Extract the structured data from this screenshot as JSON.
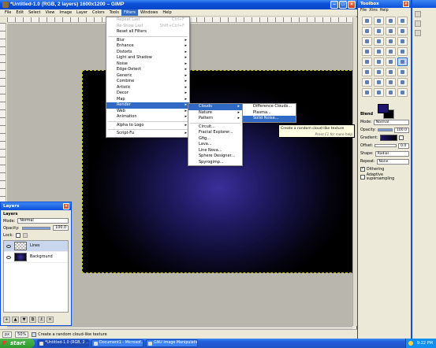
{
  "main_window": {
    "title": "*Untitled-1.0 (RGB, 2 layers) 1600x1200 – GIMP",
    "menus": [
      "File",
      "Edit",
      "Select",
      "View",
      "Image",
      "Layer",
      "Colors",
      "Tools",
      "Filters",
      "Windows",
      "Help"
    ],
    "active_menu": "Filters",
    "status": {
      "unit": "px",
      "zoom": "50%",
      "message": "Create a random cloud-like texture"
    }
  },
  "filters_menu": {
    "items": [
      {
        "label": "Repeat Last",
        "shortcut": "Ctrl+F",
        "disabled": true
      },
      {
        "label": "Re-Show Last",
        "shortcut": "Shift+Ctrl+F",
        "disabled": true
      },
      {
        "label": "Reset all Filters"
      },
      {
        "sep": true
      },
      {
        "label": "Blur",
        "sub": true
      },
      {
        "label": "Enhance",
        "sub": true
      },
      {
        "label": "Distorts",
        "sub": true
      },
      {
        "label": "Light and Shadow",
        "sub": true
      },
      {
        "label": "Noise",
        "sub": true
      },
      {
        "label": "Edge-Detect",
        "sub": true
      },
      {
        "label": "Generic",
        "sub": true
      },
      {
        "label": "Combine",
        "sub": true
      },
      {
        "label": "Artistic",
        "sub": true
      },
      {
        "label": "Decor",
        "sub": true
      },
      {
        "label": "Map",
        "sub": true
      },
      {
        "label": "Render",
        "sub": true,
        "highlight": true
      },
      {
        "label": "Web",
        "sub": true
      },
      {
        "label": "Animation",
        "sub": true
      },
      {
        "sep": true
      },
      {
        "label": "Alpha to Logo",
        "sub": true
      },
      {
        "sep": true
      },
      {
        "label": "Script-Fu",
        "sub": true
      }
    ]
  },
  "render_menu": {
    "items": [
      {
        "label": "Clouds",
        "sub": true,
        "highlight": true
      },
      {
        "label": "Nature",
        "sub": true
      },
      {
        "label": "Pattern",
        "sub": true
      },
      {
        "sep": true
      },
      {
        "label": "Circuit..."
      },
      {
        "label": "Fractal Explorer..."
      },
      {
        "label": "Gfig..."
      },
      {
        "label": "Lava..."
      },
      {
        "label": "Line Nova..."
      },
      {
        "label": "Sphere Designer..."
      },
      {
        "label": "Spyrogimp..."
      }
    ]
  },
  "clouds_menu": {
    "items": [
      {
        "label": "Difference Clouds..."
      },
      {
        "label": "Plasma..."
      },
      {
        "label": "Solid Noise...",
        "highlight": true
      }
    ]
  },
  "tooltip": {
    "text": "Create a random cloud-like texture",
    "hint": "Press F1 for more help"
  },
  "layers_dock": {
    "title": "Layers",
    "tab_label": "Layers",
    "mode_label": "Mode:",
    "mode_value": "Normal",
    "opacity_label": "Opacity:",
    "opacity_value": "100.0",
    "opacity_fraction": 1.0,
    "lock_label": "Lock:",
    "layers": [
      {
        "name": "Lines",
        "selected": true
      },
      {
        "name": "Background",
        "selected": false
      }
    ]
  },
  "toolbox": {
    "title": "Toolbox",
    "menus": [
      "File",
      "Xtns",
      "Help"
    ],
    "tool_icons": [
      "rect-select-icon",
      "ellipse-select-icon",
      "free-select-icon",
      "fuzzy-select-icon",
      "color-select-icon",
      "scissors-icon",
      "paths-icon",
      "color-picker-icon",
      "zoom-icon",
      "measure-icon",
      "move-icon",
      "crop-icon",
      "rotate-icon",
      "scale-icon",
      "shear-icon",
      "perspective-icon",
      "flip-icon",
      "text-icon",
      "bucket-fill-icon",
      "blend-icon",
      "pencil-icon",
      "paintbrush-icon",
      "eraser-icon",
      "airbrush-icon",
      "ink-icon",
      "clone-icon",
      "heal-icon",
      "perspective-clone-icon",
      "smudge-icon",
      "dodge-burn-icon",
      "convolve-icon",
      "foreground-select-icon"
    ],
    "selected_tool": 19,
    "fg_color": "#1f1470",
    "bg_color": "#000000",
    "options": {
      "title": "Blend",
      "mode_label": "Mode:",
      "mode_value": "Normal",
      "opacity_label": "Opacity:",
      "opacity_value": "100.0",
      "gradient_label": "Gradient:",
      "offset_label": "Offset:",
      "offset_value": "0.0",
      "shape_label": "Shape:",
      "shape_value": "Radial",
      "repeat_label": "Repeat:",
      "repeat_value": "None",
      "dithering_label": "Dithering",
      "adaptive_label": "Adaptive supersampling"
    }
  },
  "taskbar": {
    "start_label": "start",
    "tasks": [
      {
        "label": "*Untitled-1.0 (RGB, 2 ...",
        "active": true
      },
      {
        "label": "Document1 - Microsof...",
        "active": false
      },
      {
        "label": "GNU Image Manipulatio...",
        "active": false
      }
    ],
    "clock": "9:22 PM"
  }
}
